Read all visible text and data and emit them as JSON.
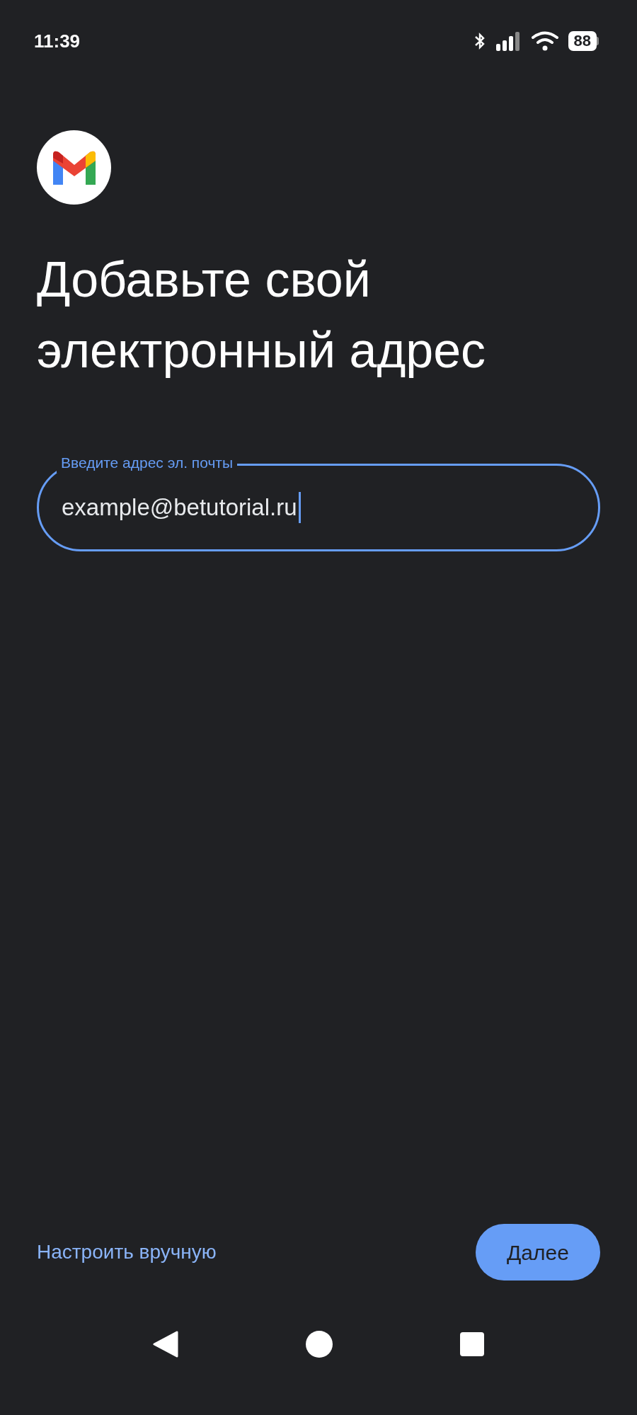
{
  "status_bar": {
    "time": "11:39",
    "battery": "88"
  },
  "title": "Добавьте свой электронный адрес",
  "email_field": {
    "label": "Введите адрес эл. почты",
    "value": "example@betutorial.ru"
  },
  "manual_link": "Настроить вручную",
  "next_button": "Далее"
}
